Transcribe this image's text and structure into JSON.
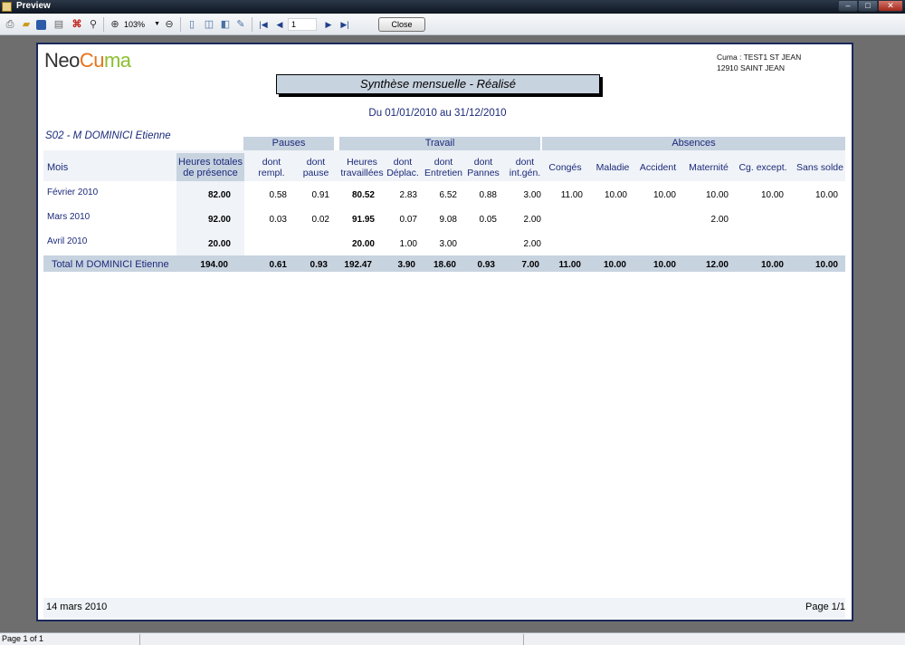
{
  "window": {
    "title": "Preview"
  },
  "toolbar": {
    "zoom": "103%",
    "page": "1",
    "close_label": "Close",
    "icons": [
      "print-icon",
      "open-icon",
      "save-icon",
      "export-icon",
      "pdf-icon",
      "find-icon",
      "zoom-in-icon",
      "zoom-out-icon",
      "single-page-icon",
      "two-page-icon",
      "book-icon",
      "edit-icon",
      "first-page-icon",
      "prev-page-icon",
      "next-page-icon",
      "last-page-icon"
    ]
  },
  "report": {
    "logo": {
      "neo": "Neo",
      "cu": "Cu",
      "ma": "ma"
    },
    "company_line1": "Cuma : TEST1  ST JEAN",
    "company_line2": "12910  SAINT JEAN",
    "title": "Synthèse mensuelle - Réalisé",
    "period": "Du 01/01/2010 au 31/12/2010",
    "employee": "S02 - M  DOMINICI  Etienne",
    "groups": {
      "pauses": "Pauses",
      "travail": "Travail",
      "absences": "Absences"
    },
    "headers": {
      "mois": "Mois",
      "heures_l1": "Heures totales",
      "heures_l2": "de présence",
      "rempl_l1": "dont",
      "rempl_l2": "rempl.",
      "pause_l1": "dont",
      "pause_l2": "pause",
      "trav_l1": "Heures",
      "trav_l2": "travaillées",
      "depl_l1": "dont",
      "depl_l2": "Déplac.",
      "entr_l1": "dont",
      "entr_l2": "Entretien",
      "pann_l1": "dont",
      "pann_l2": "Pannes",
      "intg_l1": "dont",
      "intg_l2": "int.gén.",
      "conges": "Congés",
      "maladie": "Maladie",
      "accident": "Accident",
      "maternite": "Maternité",
      "cgexcept": "Cg. except.",
      "sanssolde": "Sans solde"
    },
    "rows": [
      {
        "mois": "Février 2010",
        "heures": "82.00",
        "rempl": "0.58",
        "pause": "0.91",
        "trav": "80.52",
        "depl": "2.83",
        "entr": "6.52",
        "pann": "0.88",
        "intg": "3.00",
        "conges": "11.00",
        "maladie": "10.00",
        "accident": "10.00",
        "maternite": "10.00",
        "cgexcept": "10.00",
        "sanssolde": "10.00"
      },
      {
        "mois": "Mars 2010",
        "heures": "92.00",
        "rempl": "0.03",
        "pause": "0.02",
        "trav": "91.95",
        "depl": "0.07",
        "entr": "9.08",
        "pann": "0.05",
        "intg": "2.00",
        "maternite": "2.00"
      },
      {
        "mois": "Avril 2010",
        "heures": "20.00",
        "trav": "20.00",
        "depl": "1.00",
        "entr": "3.00",
        "intg": "2.00"
      }
    ],
    "total": {
      "label": "Total  M  DOMINICI  Etienne",
      "heures": "194.00",
      "rempl": "0.61",
      "pause": "0.93",
      "trav": "192.47",
      "depl": "3.90",
      "entr": "18.60",
      "pann": "0.93",
      "intg": "7.00",
      "conges": "11.00",
      "maladie": "10.00",
      "accident": "10.00",
      "maternite": "12.00",
      "cgexcept": "10.00",
      "sanssolde": "10.00"
    },
    "footer_date": "14 mars 2010",
    "footer_page": "Page 1/1"
  },
  "status": {
    "text": "Page 1 of 1"
  }
}
